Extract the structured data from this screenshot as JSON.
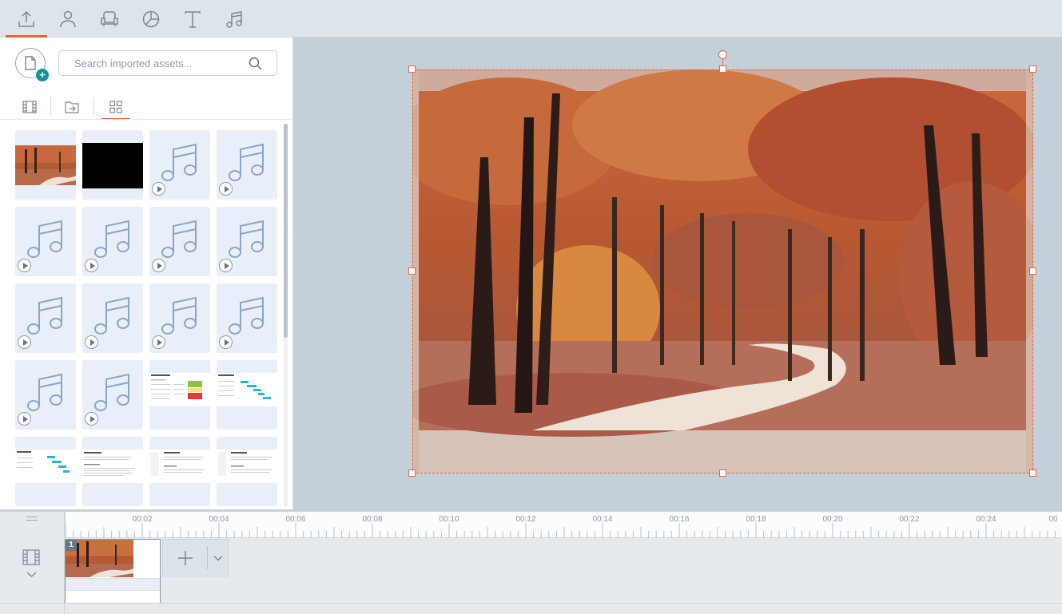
{
  "toolbar": {
    "tabs": [
      {
        "name": "upload-tab",
        "icon": "upload-icon",
        "active": true
      },
      {
        "name": "characters-tab",
        "icon": "person-icon"
      },
      {
        "name": "props-tab",
        "icon": "armchair-icon"
      },
      {
        "name": "charts-tab",
        "icon": "pie-chart-icon"
      },
      {
        "name": "text-tab",
        "icon": "text-icon"
      },
      {
        "name": "audio-tab",
        "icon": "music-note-icon"
      }
    ],
    "accent": "#e0683b"
  },
  "assets_panel": {
    "search": {
      "placeholder": "Search imported assets...",
      "value": ""
    },
    "view_tabs": [
      {
        "icon": "film-strip-icon"
      },
      {
        "icon": "folder-move-icon"
      },
      {
        "icon": "grid-view-icon",
        "active": true
      }
    ]
  },
  "timeline": {
    "ticks": [
      "00:02",
      "00:04",
      "00:06",
      "00:08",
      "00:10",
      "00:12",
      "00:14",
      "00:16",
      "00:18",
      "00:20",
      "00:22",
      "00:24",
      "00"
    ],
    "clip": {
      "index": "1"
    }
  }
}
